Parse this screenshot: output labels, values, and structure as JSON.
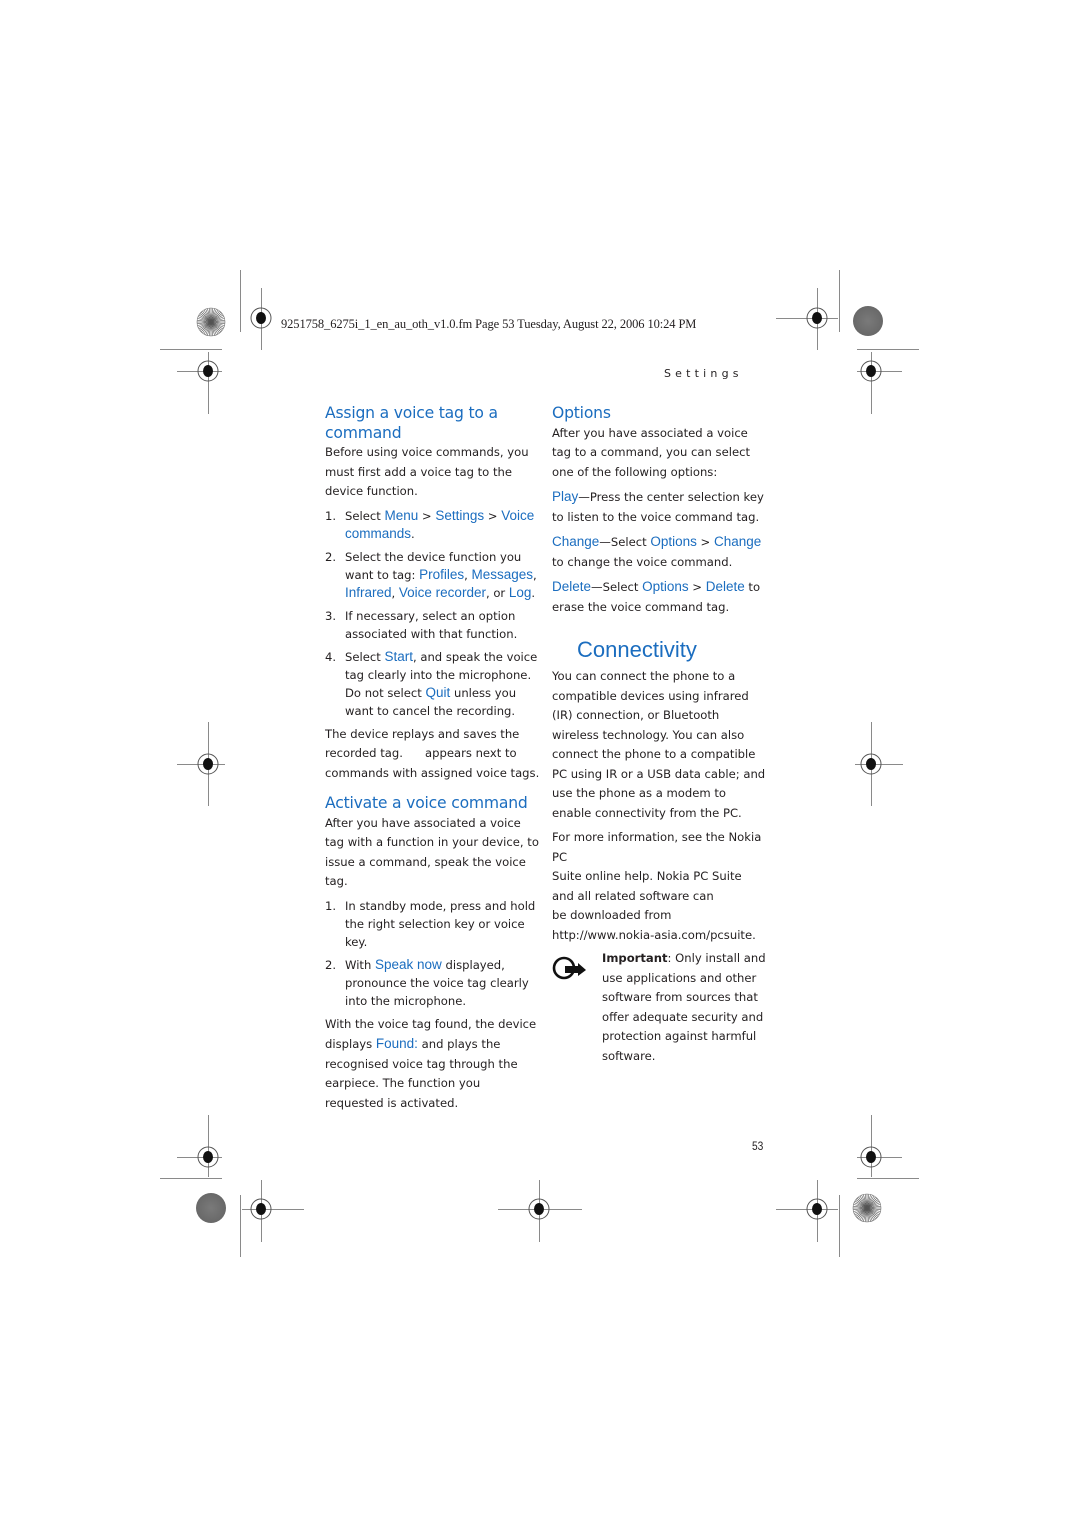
{
  "header": {
    "file_info": "9251758_6275i_1_en_au_oth_v1.0.fm  Page 53  Tuesday, August 22, 2006  10:24 PM",
    "running_head": "Settings"
  },
  "left_column": {
    "assign": {
      "heading": "Assign a voice tag to a command",
      "intro": "Before using voice commands, you must first add a voice tag to the device function.",
      "steps": [
        {
          "num": "1.",
          "pre": "Select ",
          "ui1": "Menu",
          "sep1": " > ",
          "ui2": "Settings",
          "sep2": " > ",
          "ui3": "Voice commands",
          "post": "."
        },
        {
          "num": "2.",
          "pre": "Select the device function you want to tag: ",
          "ui1": "Profiles",
          "sep1": ", ",
          "ui2": "Messages",
          "sep2": ", ",
          "ui3": "Infrared",
          "sep3": ", ",
          "ui4": "Voice recorder",
          "sep4": ", or ",
          "ui5": "Log",
          "post": "."
        },
        {
          "num": "3.",
          "text": "If necessary, select an option associated with that function."
        },
        {
          "num": "4.",
          "pre": "Select ",
          "ui1": "Start",
          "mid": ", and speak the voice tag clearly into the microphone. Do not select ",
          "ui2": "Quit",
          "post": " unless you want to cancel the recording."
        }
      ],
      "outro": "The device replays and saves the recorded tag.      appears next to commands with assigned voice tags."
    },
    "activate": {
      "heading": "Activate a voice command",
      "intro": "After you have associated a voice tag with a function in your device, to issue a command, speak the voice tag.",
      "steps": [
        {
          "num": "1.",
          "text": "In standby mode, press and hold the right selection key or voice key."
        },
        {
          "num": "2.",
          "pre": "With ",
          "ui1": "Speak now",
          "post": " displayed, pronounce the voice tag clearly into the microphone."
        }
      ],
      "outro_pre": "With the voice tag found, the device displays ",
      "outro_ui": "Found:",
      "outro_post": " and plays the recognised voice tag through the earpiece. The function you requested is activated."
    }
  },
  "right_column": {
    "options": {
      "heading": "Options",
      "intro": "After you have associated a voice tag to a command, you can select one of the following options:",
      "items": [
        {
          "ui1": "Play",
          "mid": "—Press the center selection key to listen to the voice command tag."
        },
        {
          "ui1": "Change",
          "mid": "—Select ",
          "ui2": "Options",
          "sep": " > ",
          "ui3": "Change",
          "post": " to change the voice command."
        },
        {
          "ui1": "Delete",
          "mid": "—Select ",
          "ui2": "Options",
          "sep": " > ",
          "ui3": "Delete",
          "post": " to erase the voice command tag."
        }
      ]
    },
    "connectivity": {
      "heading": "Connectivity",
      "para1": "You can connect the phone to a compatible devices using infrared (IR) connection, or Bluetooth wireless technology. You can also connect the phone to a compatible PC using IR or a USB data cable; and use the phone as a modem to enable connectivity from the PC.",
      "para2_lines": [
        "For more information, see the Nokia PC",
        "Suite online help. Nokia PC Suite",
        "and all related software can",
        "be downloaded from",
        "http://www.nokia-asia.com/pcsuite."
      ],
      "important_label": "Important",
      "important_text": ": Only install and use applications and other software from sources that offer adequate security and protection against harmful software.",
      "important_icon": "important-hand-icon"
    }
  },
  "footer": {
    "page_number": "53"
  },
  "colors": {
    "accent_blue": "#1b6dbf",
    "body_text": "#231f20",
    "crop_marks": "#8a8a8a"
  }
}
